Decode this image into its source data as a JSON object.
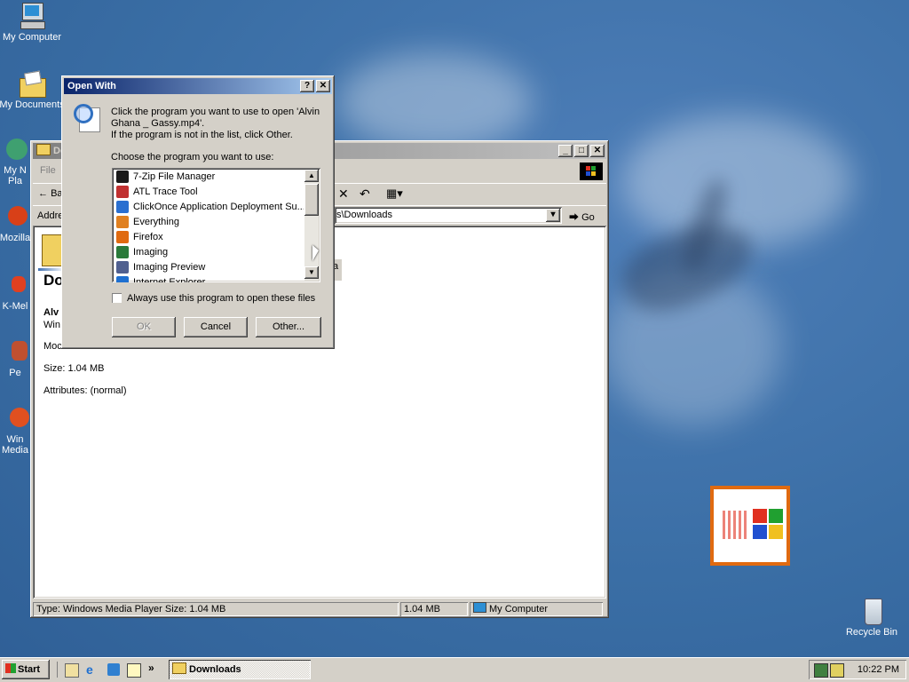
{
  "desktop": {
    "icons": [
      {
        "label": "My Computer"
      },
      {
        "label": "My Documents"
      },
      {
        "label": "My N"
      },
      {
        "label": "Pla"
      },
      {
        "label": "Mozilla"
      },
      {
        "label": "K-Mel"
      },
      {
        "label": "Pe"
      },
      {
        "label": "Win"
      },
      {
        "label": "Media"
      },
      {
        "label": "Recycle Bin"
      }
    ]
  },
  "explorer": {
    "title": "Do",
    "menu_file": "File",
    "back_label": "Ba",
    "address_label": "Addre",
    "address_value": "s\\Downloads",
    "go_label": "Go",
    "left_heading": "Do",
    "file_name": "Alv",
    "file_type": "Win",
    "modified_label": "Moc",
    "size_text": "Size: 1.04 MB",
    "attributes_text": "Attributes: (normal)",
    "partial_a": "a",
    "status": {
      "type_text": "Type: Windows Media Player Size: 1.04 MB",
      "size_text": "1.04 MB",
      "zone_text": "My Computer"
    }
  },
  "dialog": {
    "title": "Open With",
    "help_btn": "?",
    "close_btn": "✕",
    "message_line1": "Click the program you want to use to open 'Alvin",
    "message_line2": "Ghana _ Gassy.mp4'.",
    "message_line3": "If the program is not in the list, click Other.",
    "choose_label": "Choose the program you want to use:",
    "programs": [
      {
        "label": "7-Zip File Manager",
        "color": "#1a1a1a"
      },
      {
        "label": "ATL Trace Tool",
        "color": "#c03030"
      },
      {
        "label": "ClickOnce Application Deployment Su...",
        "color": "#2a6fd0"
      },
      {
        "label": "Everything",
        "color": "#e08020"
      },
      {
        "label": "Firefox",
        "color": "#e06a10"
      },
      {
        "label": "Imaging",
        "color": "#2a7a3a"
      },
      {
        "label": "Imaging Preview",
        "color": "#506090"
      },
      {
        "label": "Internet Explorer",
        "color": "#1e6fd0"
      }
    ],
    "always_use_label": "Always use this program to open these files",
    "ok_label": "OK",
    "cancel_label": "Cancel",
    "other_label": "Other..."
  },
  "taskbar": {
    "start_label": "Start",
    "task_label": "Downloads",
    "clock": "10:22 PM"
  }
}
